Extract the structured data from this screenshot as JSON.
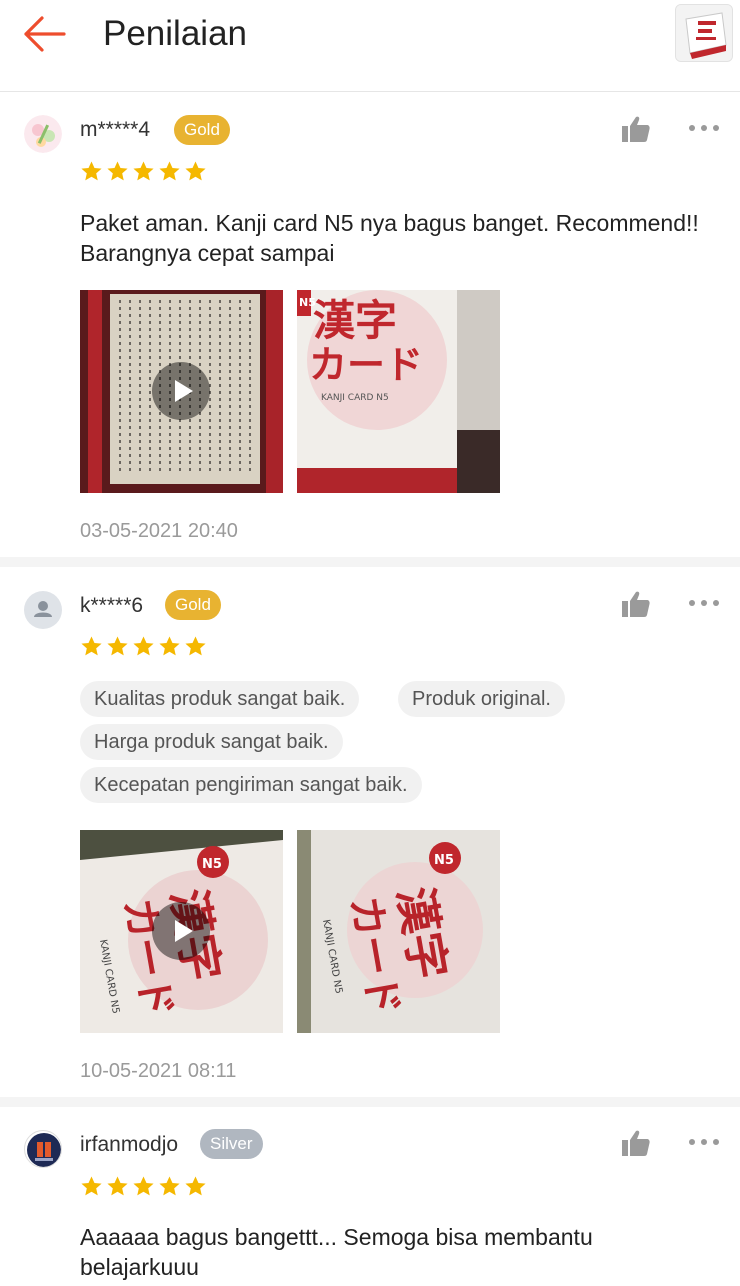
{
  "header": {
    "title": "Penilaian",
    "back_icon": "arrow-left-icon",
    "accent_color": "#ee4d2d"
  },
  "reviews": [
    {
      "username": "m*****4",
      "badge": "Gold",
      "rating": 5,
      "text": "Paket aman. Kanji card N5 nya bagus banget. Recommend!! Barangnya cepat sampai",
      "media": [
        {
          "kind": "video",
          "label": "video thumbnail"
        },
        {
          "kind": "photo",
          "label": "photo thumbnail",
          "text": "漢字カード",
          "subtext": "KANJI CARD N5"
        }
      ],
      "timestamp": "03-05-2021 20:40"
    },
    {
      "username": "k*****6",
      "badge": "Gold",
      "rating": 5,
      "tags": [
        "Kualitas produk sangat baik.",
        "Produk original.",
        "Harga produk sangat baik.",
        "Kecepatan pengiriman sangat baik."
      ],
      "media": [
        {
          "kind": "video",
          "label": "video thumbnail",
          "badge": "N5"
        },
        {
          "kind": "photo",
          "label": "photo thumbnail",
          "badge": "N5",
          "subtext": "KANJI CARD N5"
        }
      ],
      "timestamp": "10-05-2021 08:11"
    },
    {
      "username": "irfanmodjo",
      "badge": "Silver",
      "rating": 5,
      "text": "Aaaaaa bagus bangettt... Semoga bisa membantu belajarkuuu"
    }
  ],
  "colors": {
    "gold": "#e8b331",
    "silver": "#b0b7c0",
    "star": "#f5b800",
    "timestamp": "#9a9a9a"
  }
}
